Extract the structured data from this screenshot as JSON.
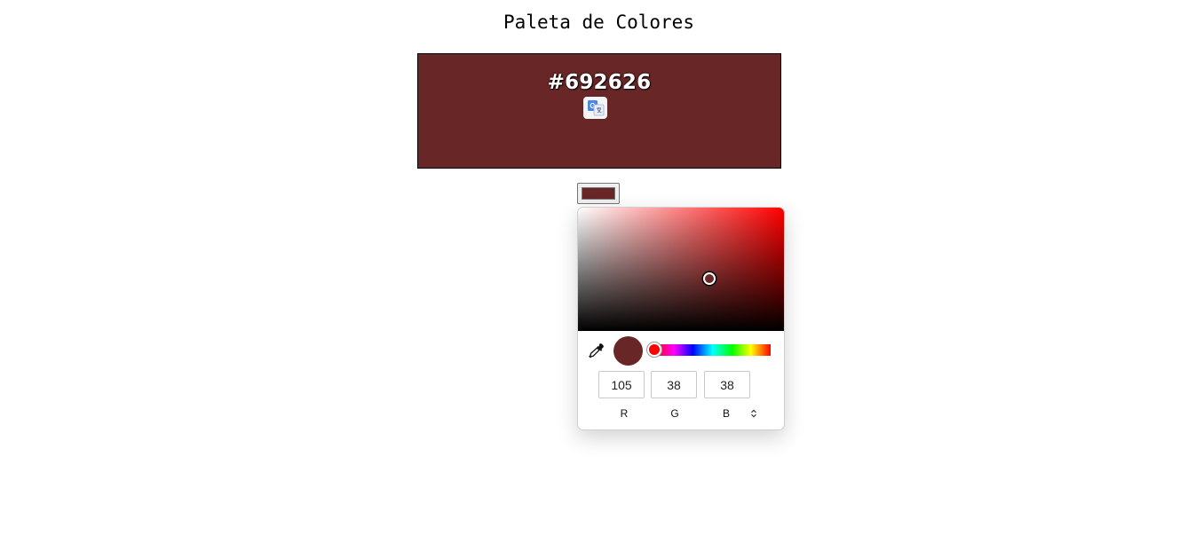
{
  "page": {
    "title": "Paleta de Colores"
  },
  "display": {
    "hex": "#692626",
    "color": "#692626"
  },
  "picker": {
    "selected_color": "#692626",
    "hue_color": "#ff0000",
    "rgb": {
      "r": "105",
      "g": "38",
      "b": "38"
    },
    "labels": {
      "r": "R",
      "g": "G",
      "b": "B"
    },
    "format_toggle_icon": "up-down-arrows-icon"
  },
  "icons": {
    "translate": "google-translate-icon",
    "eyedropper": "eyedropper-icon"
  }
}
